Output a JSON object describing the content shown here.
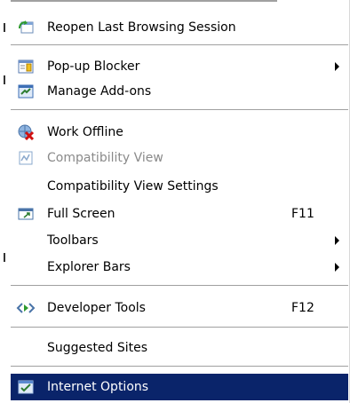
{
  "menu": {
    "items": [
      {
        "label": "Reopen Last Browsing Session",
        "icon": "reopen-session-icon"
      },
      {
        "label": "Pop-up Blocker",
        "icon": "popup-blocker-icon",
        "submenu": true
      },
      {
        "label": "Manage Add-ons",
        "icon": "manage-addons-icon"
      },
      {
        "label": "Work Offline",
        "icon": "work-offline-icon"
      },
      {
        "label": "Compatibility View",
        "icon": "compatibility-view-icon",
        "disabled": true
      },
      {
        "label": "Compatibility View Settings"
      },
      {
        "label": "Full Screen",
        "icon": "full-screen-icon",
        "shortcut": "F11"
      },
      {
        "label": "Toolbars",
        "submenu": true
      },
      {
        "label": "Explorer Bars",
        "submenu": true
      },
      {
        "label": "Developer Tools",
        "icon": "developer-tools-icon",
        "shortcut": "F12"
      },
      {
        "label": "Suggested Sites"
      },
      {
        "label": "Internet Options",
        "icon": "internet-options-icon",
        "selected": true
      }
    ]
  },
  "colors": {
    "selection_bg": "#0a246a",
    "disabled_text": "#8a8a8a",
    "separator": "#a0a0a0"
  }
}
